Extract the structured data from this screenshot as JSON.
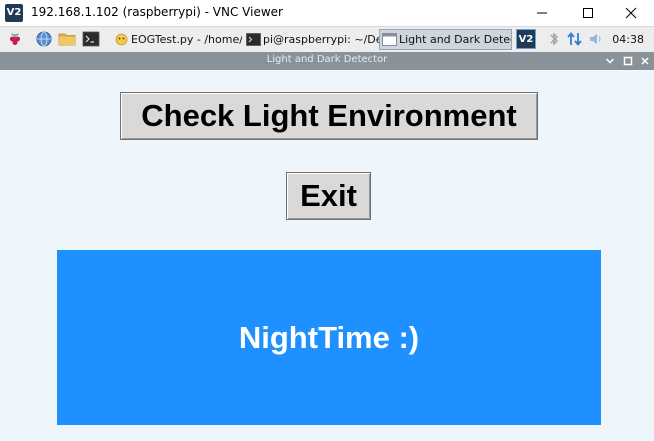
{
  "vnc_window": {
    "title": "192.168.1.102 (raspberrypi) - VNC Viewer",
    "logo_text": "V2"
  },
  "taskbar": {
    "launchers": [
      "raspberry-menu-icon",
      "globe-icon",
      "folder-icon",
      "terminal-icon"
    ],
    "tasks": [
      {
        "label": "EOGTest.py - /home/...",
        "icon": "python-file-icon"
      },
      {
        "label": "pi@raspberrypi: ~/De...",
        "icon": "terminal-icon"
      },
      {
        "label": "Light and Dark Detec...",
        "icon": "window-icon",
        "active": true
      }
    ],
    "tray": {
      "vnc_logo_text": "V2",
      "icons": [
        "bluetooth-icon",
        "network-arrows-icon",
        "volume-icon"
      ],
      "clock": "04:38"
    }
  },
  "app_window": {
    "title": "Light and Dark Detector"
  },
  "app": {
    "check_button_label": "Check Light Environment",
    "exit_button_label": "Exit",
    "status_text": "NightTime :)",
    "status_color": "#1e90ff",
    "background_color": "#eef5fb"
  }
}
